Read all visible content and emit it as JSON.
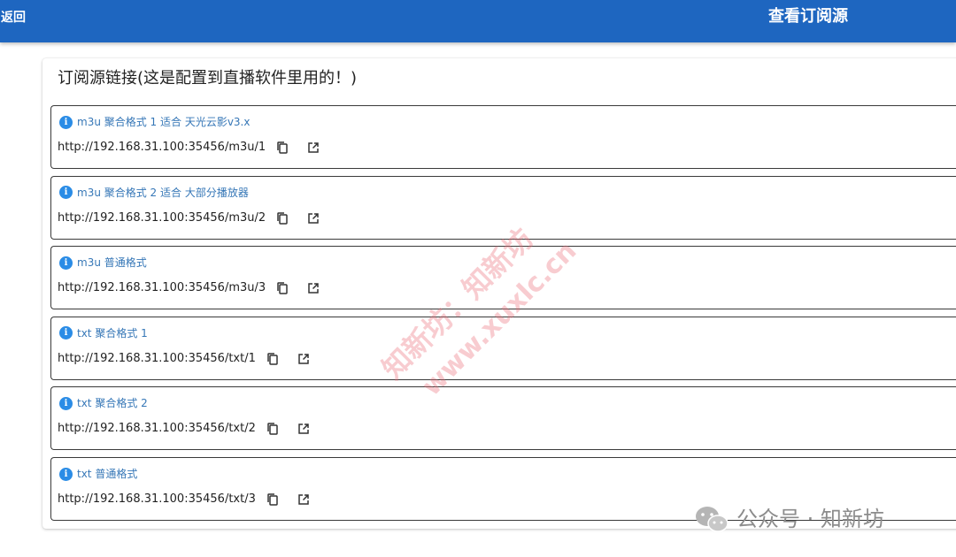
{
  "header": {
    "back_label": "返回",
    "title": "查看订阅源",
    "bg_color": "#1e66c0"
  },
  "panel": {
    "title": "订阅源链接(这是配置到直播软件里用的！)"
  },
  "feeds": [
    {
      "label": "m3u 聚合格式 1 适合 天光云影v3.x",
      "url": "http://192.168.31.100:35456/m3u/1",
      "info_icon": "i",
      "copy_icon": "copy-icon",
      "open_icon": "open-in-new-icon"
    },
    {
      "label": "m3u 聚合格式 2 适合 大部分播放器",
      "url": "http://192.168.31.100:35456/m3u/2",
      "info_icon": "i",
      "copy_icon": "copy-icon",
      "open_icon": "open-in-new-icon"
    },
    {
      "label": "m3u 普通格式",
      "url": "http://192.168.31.100:35456/m3u/3",
      "info_icon": "i",
      "copy_icon": "copy-icon",
      "open_icon": "open-in-new-icon"
    },
    {
      "label": "txt 聚合格式 1",
      "url": "http://192.168.31.100:35456/txt/1",
      "info_icon": "i",
      "copy_icon": "copy-icon",
      "open_icon": "open-in-new-icon"
    },
    {
      "label": "txt 聚合格式 2",
      "url": "http://192.168.31.100:35456/txt/2",
      "info_icon": "i",
      "copy_icon": "copy-icon",
      "open_icon": "open-in-new-icon"
    },
    {
      "label": "txt 普通格式",
      "url": "http://192.168.31.100:35456/txt/3",
      "info_icon": "i",
      "copy_icon": "copy-icon",
      "open_icon": "open-in-new-icon"
    }
  ],
  "watermark": {
    "line1": "知新坊：知新坊",
    "line2": "www.xuxlc.cn"
  },
  "footer": {
    "brand_text": "公众号 · 知新坊",
    "icon": "wechat-icon"
  },
  "colors": {
    "accent": "#2a8ce6",
    "label_text": "#3677b7",
    "border": "#3a3a3a"
  }
}
